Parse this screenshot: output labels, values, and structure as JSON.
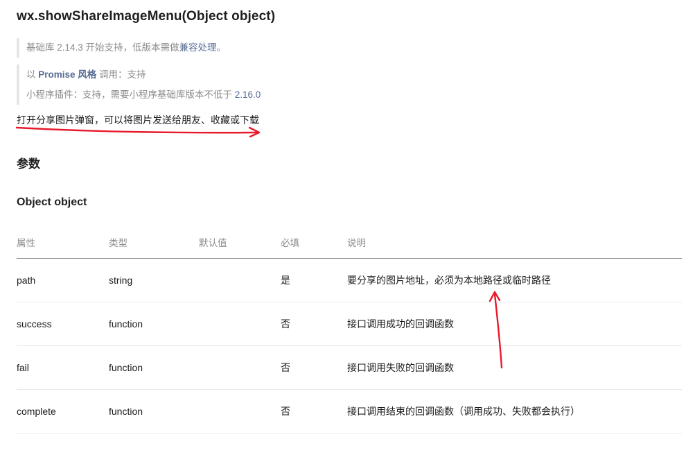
{
  "api_title": "wx.showShareImageMenu(Object object)",
  "support": {
    "prefix": "基础库 2.14.3 开始支持，低版本需做",
    "link": "兼容处理",
    "suffix": "。"
  },
  "promise": {
    "prefix": "以 ",
    "link": "Promise 风格",
    "suffix": " 调用：支持"
  },
  "plugin": {
    "prefix": "小程序插件：支持，需要小程序基础库版本不低于 ",
    "version": "2.16.0"
  },
  "description": "打开分享图片弹窗，可以将图片发送给朋友、收藏或下载",
  "params_heading": "参数",
  "object_heading": "Object object",
  "table": {
    "headers": [
      "属性",
      "类型",
      "默认值",
      "必填",
      "说明"
    ],
    "rows": [
      [
        "path",
        "string",
        "",
        "是",
        "要分享的图片地址，必须为本地路径或临时路径"
      ],
      [
        "success",
        "function",
        "",
        "否",
        "接口调用成功的回调函数"
      ],
      [
        "fail",
        "function",
        "",
        "否",
        "接口调用失败的回调函数"
      ],
      [
        "complete",
        "function",
        "",
        "否",
        "接口调用结束的回调函数（调用成功、失败都会执行）"
      ]
    ]
  },
  "colors": {
    "annotation_red": "#e8192c",
    "link_blue": "#576b95"
  }
}
